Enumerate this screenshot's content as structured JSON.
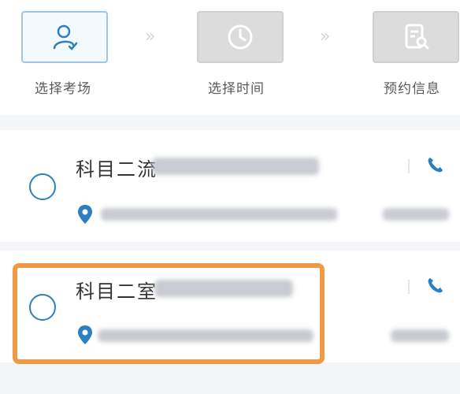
{
  "steps": [
    {
      "label": "选择考场",
      "icon": "user-check-icon",
      "state": "active"
    },
    {
      "label": "选择时间",
      "icon": "clock-icon",
      "state": "inactive"
    },
    {
      "label": "预约信息",
      "icon": "document-search-icon",
      "state": "inactive"
    }
  ],
  "step_separator": "»",
  "venues": [
    {
      "name": "科目二流",
      "selected": false
    },
    {
      "name": "科目二室",
      "selected": false
    }
  ],
  "colors": {
    "accent": "#2d7fc0",
    "highlight": "#ef9a46",
    "inactive_step": "#dcdcdc",
    "background": "#f3f5f8"
  }
}
